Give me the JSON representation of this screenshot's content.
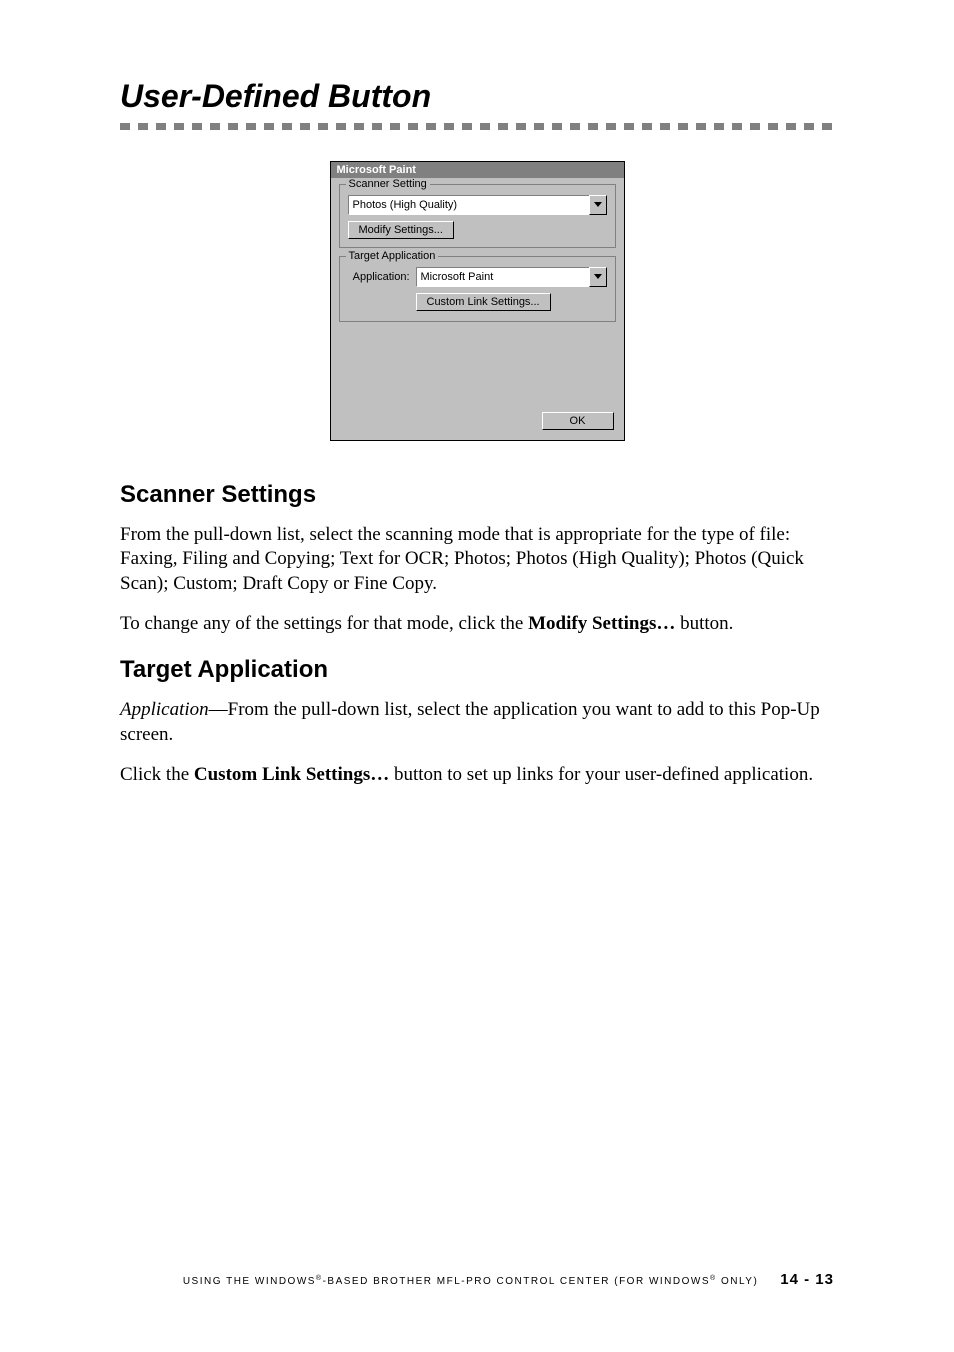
{
  "section_title": "User-Defined Button",
  "dialog": {
    "title": "Microsoft Paint",
    "scanner_group_legend": "Scanner Setting",
    "scanner_mode_value": "Photos (High Quality)",
    "modify_settings_label": "Modify Settings...",
    "target_group_legend": "Target Application",
    "application_label": "Application:",
    "application_value": "Microsoft Paint",
    "custom_link_label": "Custom Link Settings...",
    "ok_label": "OK"
  },
  "subhead1": "Scanner Settings",
  "para1": "From the pull-down list, select the scanning mode that is appropriate for the type of file:  Faxing, Filing and Copying; Text for OCR; Photos; Photos (High Quality); Photos (Quick Scan); Custom; Draft Copy or Fine Copy.",
  "para2_pre": "To change any of the settings for that mode, click the ",
  "para2_bold": "Modify Settings…",
  "para2_post": " button.",
  "subhead2": "Target Application",
  "para3_ital": "Application",
  "para3_rest": "—From the pull-down list, select the application you want to add to this Pop-Up screen.",
  "para4_pre": "Click the ",
  "para4_bold": "Custom Link Settings…",
  "para4_post": " button to set up links for your user-defined application.",
  "footer": {
    "text_pre": "USING THE WINDOWS",
    "reg1": "®",
    "text_mid": "-BASED BROTHER MFL-PRO CONTROL CENTER (FOR WINDOWS",
    "reg2": "®",
    "text_post": " ONLY)",
    "page": "14 - 13"
  }
}
